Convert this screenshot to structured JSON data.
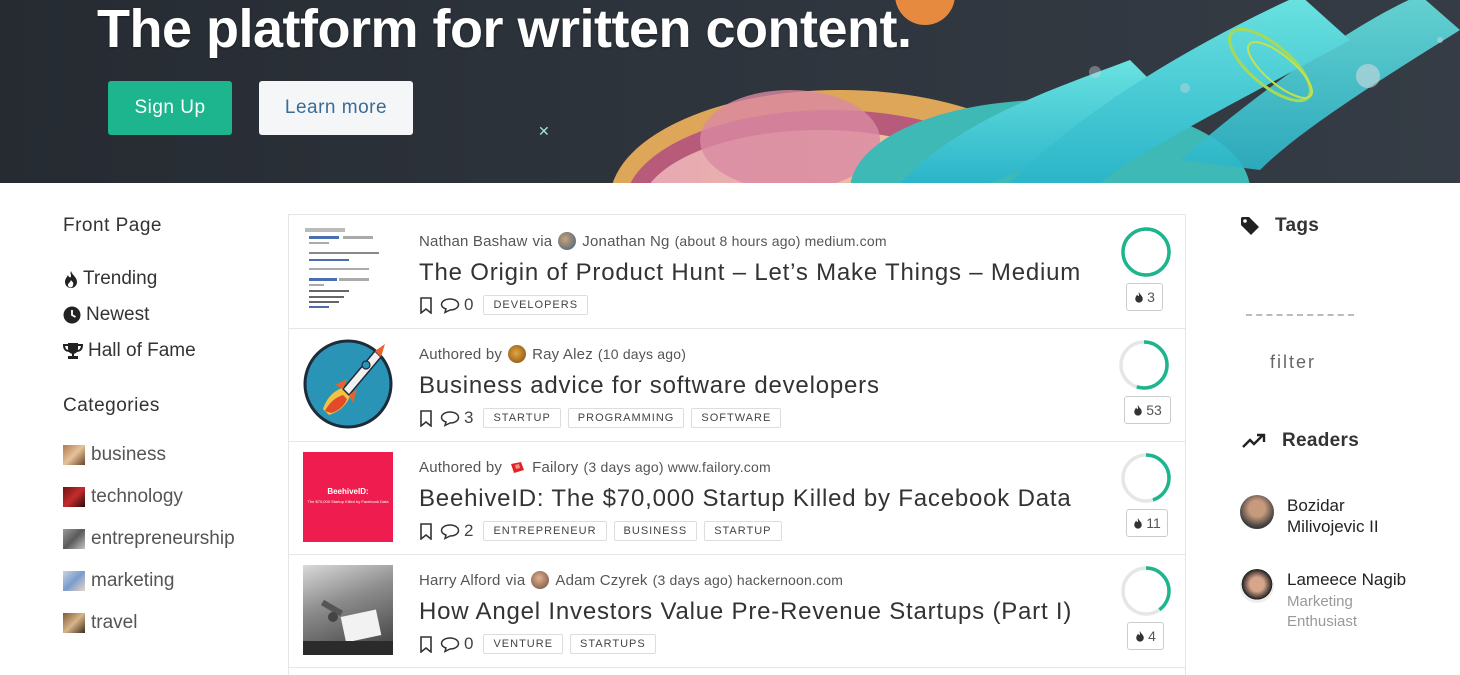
{
  "hero": {
    "headline": "The platform for written content.",
    "signup_label": "Sign Up",
    "learn_label": "Learn more"
  },
  "sidebar": {
    "front_page_title": "Front Page",
    "nav": [
      {
        "label": "Trending",
        "icon": "flame-icon"
      },
      {
        "label": "Newest",
        "icon": "clock-icon"
      },
      {
        "label": "Hall of Fame",
        "icon": "trophy-icon"
      }
    ],
    "categories_title": "Categories",
    "categories": [
      "business",
      "technology",
      "entrepreneurship",
      "marketing",
      "travel"
    ]
  },
  "feed": {
    "items": [
      {
        "author": "Nathan Bashaw",
        "connector": "via",
        "poster": "Jonathan Ng",
        "time": "(about 8 hours ago)",
        "domain": "medium.com",
        "title": "The Origin of Product Hunt – Let’s Make Things – Medium",
        "comments": "0",
        "tags": [
          "DEVELOPERS"
        ],
        "votes": "3",
        "score": 1.0
      },
      {
        "prefix": "Authored by",
        "poster": "Ray Alez",
        "time": "(10 days ago)",
        "domain": "",
        "title": "Business advice for software developers",
        "comments": "3",
        "tags": [
          "STARTUP",
          "PROGRAMMING",
          "SOFTWARE"
        ],
        "votes": "53",
        "score": 0.55
      },
      {
        "prefix": "Authored by",
        "poster": "Failory",
        "time": "(3 days ago)",
        "domain": "www.failory.com",
        "title": "BeehiveID: The $70,000 Startup Killed by Facebook Data",
        "comments": "2",
        "tags": [
          "ENTREPRENEUR",
          "BUSINESS",
          "STARTUP"
        ],
        "votes": "11",
        "score": 0.45,
        "thumb_title": "BeehiveID:",
        "thumb_sub": "The $70,000 Startup Killed by Facebook Data"
      },
      {
        "author": "Harry Alford",
        "connector": "via",
        "poster": "Adam Czyrek",
        "time": "(3 days ago)",
        "domain": "hackernoon.com",
        "title": "How Angel Investors Value Pre-Revenue Startups (Part I)",
        "comments": "0",
        "tags": [
          "VENTURE",
          "STARTUPS"
        ],
        "votes": "4",
        "score": 0.4
      }
    ]
  },
  "right": {
    "tags_title": "Tags",
    "filter_label": "filter",
    "readers_title": "Readers",
    "readers": [
      {
        "name": "Bozidar Milivojevic II",
        "role": ""
      },
      {
        "name": "Lameece Nagib",
        "role": "Marketing Enthusiast"
      }
    ]
  },
  "colors": {
    "accent": "#1db58d",
    "brand_link": "#3a6c96",
    "hero_bg": "#2a3038",
    "thumb_red": "#ef1d4f"
  }
}
